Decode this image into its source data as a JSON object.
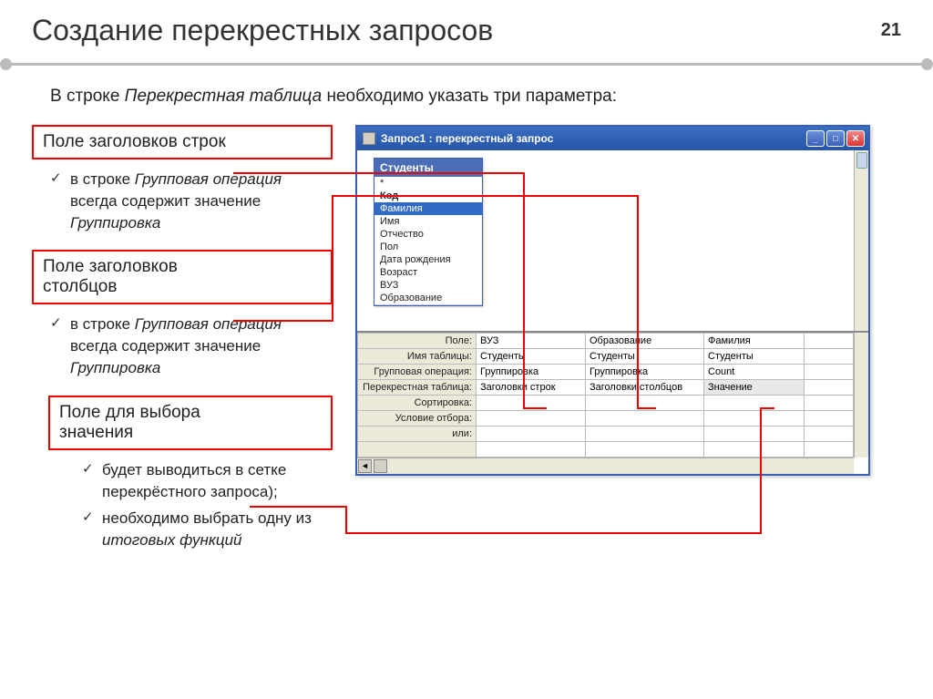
{
  "page_number": "21",
  "title": "Создание перекрестных запросов",
  "intro_pre": "В строке ",
  "intro_it": "Перекрестная таблица",
  "intro_post": " необходимо указать три параметра:",
  "box1": "Поле заголовков строк",
  "box2_l1": "Поле заголовков",
  "box2_l2": "столбцов",
  "box3_l1": "Поле для выбора",
  "box3_l2": "значения",
  "bullet1_pre": "в строке ",
  "bullet1_it1": "Групповая операция",
  "bullet1_mid": " всегда содержит значение ",
  "bullet1_it2": "Группировка",
  "bullet3a": "будет выводиться в сетке перекрёстного запроса);",
  "bullet3b_pre": "необходимо выбрать одну из ",
  "bullet3b_it": "итоговых функций",
  "win_title": "Запрос1 : перекрестный запрос",
  "table_name": "Студенты",
  "fields": {
    "f0": "*",
    "f1": "Код",
    "f2": "Фамилия",
    "f3": "Имя",
    "f4": "Отчество",
    "f5": "Пол",
    "f6": "Дата рождения",
    "f7": "Возраст",
    "f8": "ВУЗ",
    "f9": "Образование"
  },
  "grid_labels": {
    "l1": "Поле:",
    "l2": "Имя таблицы:",
    "l3": "Групповая операция:",
    "l4": "Перекрестная таблица:",
    "l5": "Сортировка:",
    "l6": "Условие отбора:",
    "l7": "или:"
  },
  "grid_cols": {
    "c1": {
      "field": "ВУЗ",
      "table": "Студенты",
      "op": "Группировка",
      "cross": "Заголовки строк"
    },
    "c2": {
      "field": "Образование",
      "table": "Студенты",
      "op": "Группировка",
      "cross": "Заголовки столбцов"
    },
    "c3": {
      "field": "Фамилия",
      "table": "Студенты",
      "op": "Count",
      "cross": "Значение"
    }
  }
}
